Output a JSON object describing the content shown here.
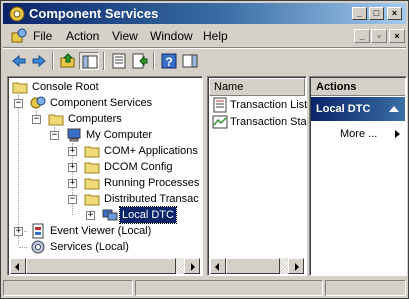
{
  "window": {
    "title": "Component Services"
  },
  "title_buttons": {
    "minimize": "_",
    "maximize": "□",
    "close": "×"
  },
  "menu": {
    "items": [
      {
        "label": "File"
      },
      {
        "label": "Action"
      },
      {
        "label": "View"
      },
      {
        "label": "Window"
      },
      {
        "label": "Help"
      }
    ],
    "mdi": {
      "minimize": "_",
      "restore": "▫",
      "close": "×"
    }
  },
  "toolbar": {
    "buttons": [
      "back-icon",
      "forward-icon",
      "up-folder-icon",
      "show-hide-tree-icon",
      "properties-icon",
      "export-list-icon",
      "help-icon",
      "show-hide-action-pane-icon"
    ]
  },
  "tree": {
    "items": [
      {
        "label": "Console Root",
        "icon": "folder-icon"
      },
      {
        "label": "Component Services",
        "icon": "component-services-icon"
      },
      {
        "label": "Computers",
        "icon": "folder-icon"
      },
      {
        "label": "My Computer",
        "icon": "computer-icon"
      },
      {
        "label": "COM+ Applications",
        "icon": "folder-icon"
      },
      {
        "label": "DCOM Config",
        "icon": "folder-icon"
      },
      {
        "label": "Running Processes",
        "icon": "folder-icon"
      },
      {
        "label": "Distributed Transac",
        "icon": "folder-icon"
      },
      {
        "label": "Local DTC",
        "icon": "dtc-icon",
        "selected": true
      },
      {
        "label": "Event Viewer (Local)",
        "icon": "event-viewer-icon"
      },
      {
        "label": "Services (Local)",
        "icon": "services-icon"
      }
    ]
  },
  "list": {
    "column": "Name",
    "items": [
      {
        "label": "Transaction List",
        "icon": "list-icon"
      },
      {
        "label": "Transaction Sta",
        "icon": "statistics-icon"
      }
    ]
  },
  "actions": {
    "header": "Actions",
    "section": "Local DTC",
    "items": [
      {
        "label": "More ..."
      }
    ]
  },
  "colors": {
    "title_active": "#0a246a",
    "face": "#d4d0c8",
    "selection": "#0a246a"
  }
}
